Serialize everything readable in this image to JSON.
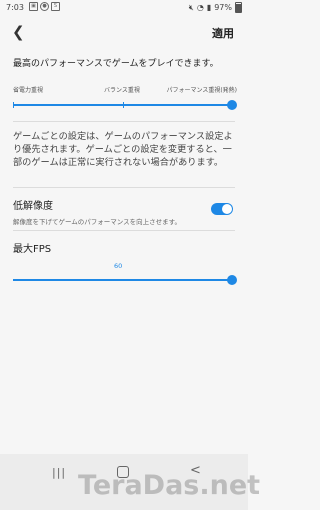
{
  "status_bar": {
    "time": "7:03",
    "icons_left": [
      "image-icon",
      "record-icon",
      "app-icon"
    ],
    "battery_text": "97%"
  },
  "header": {
    "back_icon": "back-arrow-icon",
    "apply_label": "適用"
  },
  "performance": {
    "description": "最高のパフォーマンスでゲームをプレイできます。",
    "labels": [
      "省電力重視",
      "バランス重視",
      "パフォーマンス重視(発熱)"
    ],
    "level_fraction": 1.0
  },
  "warning_text": "ゲームごとの設定は、ゲームのパフォーマンス設定より優先されます。ゲームごとの設定を変更すると、一部のゲームは正常に実行されない場合があります。",
  "low_resolution": {
    "title": "低解像度",
    "subtitle": "解像度を下げてゲームのパフォーマンスを向上させます。",
    "enabled": true
  },
  "max_fps": {
    "title": "最大FPS",
    "value": "60",
    "level_fraction": 1.0
  },
  "nav_bar": {
    "recents_glyph": "|||",
    "back_glyph": "<"
  },
  "watermark": "TeraDas.net",
  "colors": {
    "accent": "#1e88e5"
  }
}
